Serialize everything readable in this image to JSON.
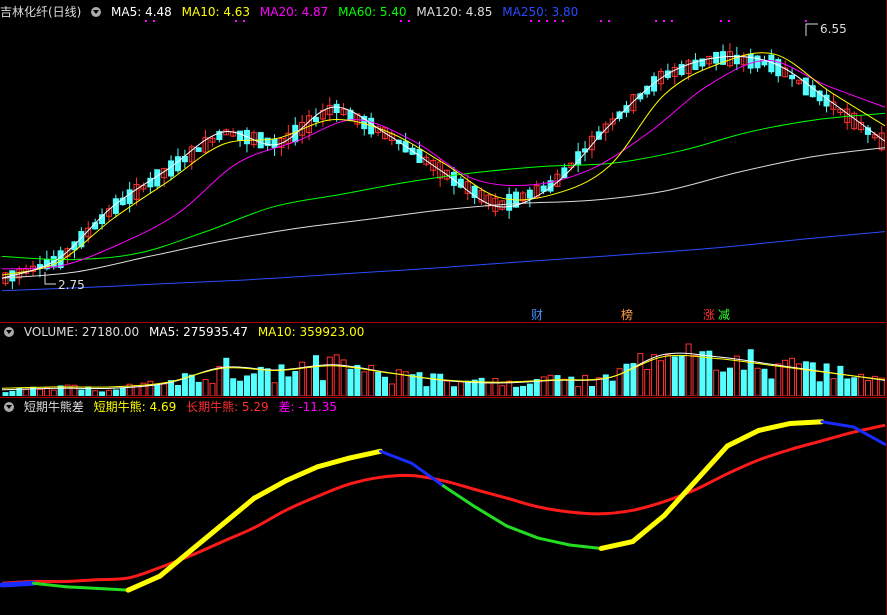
{
  "main_header": {
    "title": "吉林化纤(日线)",
    "ma_labels": [
      {
        "text": "MA5: 4.48",
        "color": "#ffffff"
      },
      {
        "text": "MA10: 4.63",
        "color": "#ffff00"
      },
      {
        "text": "MA20: 4.87",
        "color": "#ff00ff"
      },
      {
        "text": "MA60: 5.40",
        "color": "#00ff00"
      },
      {
        "text": "MA120: 4.85",
        "color": "#dddddd"
      },
      {
        "text": "MA250: 3.80",
        "color": "#2a4bff"
      }
    ]
  },
  "volume_header": {
    "labels": [
      {
        "text": "VOLUME: 27180.00",
        "color": "#dddddd"
      },
      {
        "text": "MA5: 275935.47",
        "color": "#ffffff"
      },
      {
        "text": "MA10: 359923.00",
        "color": "#ffff00"
      }
    ]
  },
  "indicator_header": {
    "name": "短期牛熊差",
    "labels": [
      {
        "text": "短期牛熊: 4.69",
        "color": "#ffff00"
      },
      {
        "text": "长期牛熊: 5.29",
        "color": "#ff3030"
      },
      {
        "text": "差: -11.35",
        "color": "#ff00ff"
      }
    ]
  },
  "markers": [
    {
      "text": "财",
      "color": "#4a8fff"
    },
    {
      "text": "榜",
      "color": "#ffa040"
    },
    {
      "text": "涨",
      "color": "#ff3030"
    },
    {
      "text": "减",
      "color": "#30ff30"
    }
  ],
  "price_labels": {
    "high": "6.55",
    "low": "2.75"
  },
  "colors": {
    "up": "#ff3030",
    "down": "#54ffff",
    "bg": "#000000",
    "grid": "#b00000"
  },
  "chart_data": {
    "type": "line",
    "price": {
      "ylim": [
        2.4,
        6.9
      ],
      "ma250": [
        2.55,
        2.6,
        2.66,
        2.72,
        2.8,
        2.88,
        2.97,
        3.06,
        3.15,
        3.25,
        3.38,
        3.5
      ],
      "ma120": [
        2.75,
        2.85,
        3.1,
        3.35,
        3.55,
        3.7,
        3.85,
        3.95,
        4.0,
        4.15,
        4.45,
        4.7,
        4.85
      ],
      "ma60": [
        3.1,
        3.05,
        3.15,
        3.5,
        3.9,
        4.1,
        4.3,
        4.45,
        4.55,
        4.6,
        4.8,
        5.1,
        5.3,
        5.4
      ],
      "ma20": [
        2.9,
        2.95,
        3.3,
        3.8,
        4.6,
        4.95,
        5.3,
        4.95,
        4.35,
        4.25,
        4.5,
        5.1,
        5.85,
        6.25,
        5.85,
        5.5
      ],
      "ma10": [
        2.8,
        3.0,
        3.7,
        4.3,
        4.9,
        5.0,
        5.3,
        5.1,
        4.6,
        4.05,
        4.1,
        4.55,
        5.7,
        6.2,
        6.35,
        5.75,
        5.2
      ],
      "ma5": [
        2.75,
        3.05,
        3.9,
        4.5,
        5.1,
        4.9,
        5.5,
        5.05,
        4.45,
        3.9,
        4.25,
        5.2,
        6.0,
        6.3,
        6.2,
        5.6,
        4.95
      ]
    },
    "short_bull_bear": {
      "ylim": [
        -1.0,
        10.0
      ],
      "values": [
        0.5,
        0.6,
        0.4,
        0.3,
        0.2,
        1.0,
        2.5,
        4.0,
        5.5,
        6.5,
        7.3,
        7.8,
        8.2,
        7.5,
        6.2,
        5.0,
        3.9,
        3.2,
        2.8,
        2.6,
        3.0,
        4.5,
        6.5,
        8.5,
        9.4,
        9.8,
        9.9,
        9.6,
        8.6
      ]
    },
    "long_bull_bear": {
      "ylim": [
        -1.0,
        10.0
      ],
      "values": [
        0.6,
        0.7,
        0.7,
        0.8,
        0.9,
        1.5,
        2.2,
        3.0,
        3.8,
        4.8,
        5.6,
        6.3,
        6.7,
        6.8,
        6.5,
        6.0,
        5.5,
        5.0,
        4.7,
        4.6,
        4.8,
        5.3,
        6.0,
        6.9,
        7.7,
        8.3,
        8.8,
        9.3,
        9.7
      ]
    }
  }
}
